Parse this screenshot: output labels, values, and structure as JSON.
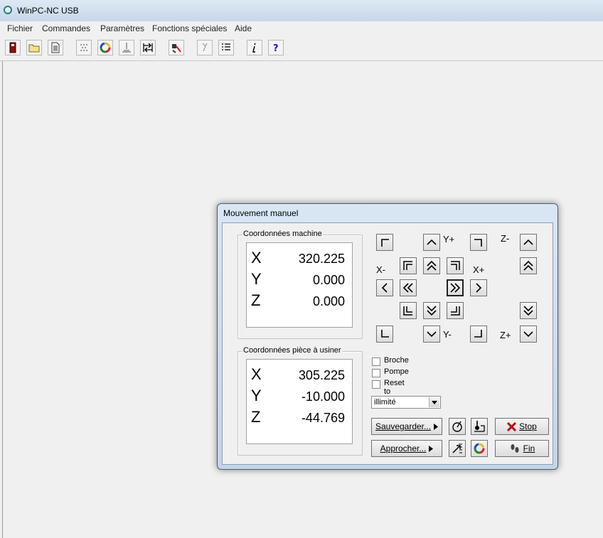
{
  "window": {
    "title": "WinPC-NC USB"
  },
  "menu": [
    "Fichier",
    "Commandes",
    "Paramètres",
    "Fonctions spéciales",
    "Aide"
  ],
  "toolbar_icons": [
    "exit-icon",
    "open-folder-icon",
    "document-icon",
    "grid-icon",
    "color-wheel-icon",
    "tool-icon",
    "reference-icon",
    "tool-change-icon",
    "pen-icon",
    "list-icon",
    "info-icon",
    "help-icon"
  ],
  "dialog": {
    "title": "Mouvement manuel",
    "machine": {
      "label": "Coordonnées machine",
      "rows": [
        {
          "axis": "X",
          "value": "320.225"
        },
        {
          "axis": "Y",
          "value": "0.000"
        },
        {
          "axis": "Z",
          "value": "0.000"
        }
      ]
    },
    "workpiece": {
      "label": "Coordonnées pièce à usiner",
      "rows": [
        {
          "axis": "X",
          "value": "305.225"
        },
        {
          "axis": "Y",
          "value": "-10.000"
        },
        {
          "axis": "Z",
          "value": "-44.769"
        }
      ]
    },
    "jog_labels": {
      "y_plus": "Y+",
      "y_minus": "Y-",
      "x_minus": "X-",
      "x_plus": "X+",
      "z_minus": "Z-",
      "z_plus": "Z+"
    },
    "checkboxes": [
      {
        "label": "Broche",
        "checked": false
      },
      {
        "label": "Pompe",
        "checked": false
      },
      {
        "label": "Reset to endless",
        "checked": false
      }
    ],
    "step_select": "illimité",
    "buttons": {
      "save": "Sauvegarder...",
      "approach": "Approcher...",
      "stop": "Stop",
      "end": "Fin"
    }
  }
}
